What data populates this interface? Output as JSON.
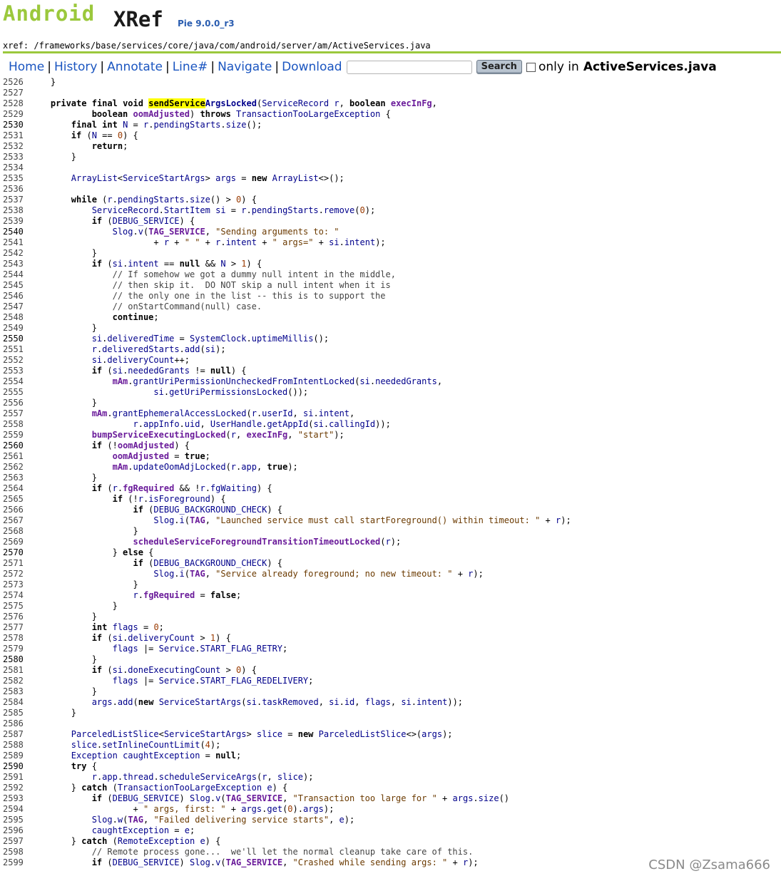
{
  "logo": {
    "android": "Android",
    "xref": "XRef",
    "version": "Pie 9.0.0_r3"
  },
  "path": "xref: /frameworks/base/services/core/java/com/android/server/am/ActiveServices.java",
  "nav": {
    "home": "Home",
    "history": "History",
    "annotate": "Annotate",
    "line": "Line#",
    "navigate": "Navigate",
    "download": "Download",
    "search_value": "",
    "search_button": "Search",
    "only_in_label": "only in",
    "only_in_file": "ActiveServices.java"
  },
  "code": {
    "lines": [
      {
        "n": "2526",
        "t": "    }"
      },
      {
        "n": "2527",
        "t": ""
      },
      {
        "n": "2528",
        "t": "    private final void sendServiceArgsLocked(ServiceRecord r, boolean execInFg,"
      },
      {
        "n": "2529",
        "t": "            boolean oomAdjusted) throws TransactionTooLargeException {"
      },
      {
        "n": "2530",
        "t": "        final int N = r.pendingStarts.size();"
      },
      {
        "n": "2531",
        "t": "        if (N == 0) {"
      },
      {
        "n": "2532",
        "t": "            return;"
      },
      {
        "n": "2533",
        "t": "        }"
      },
      {
        "n": "2534",
        "t": ""
      },
      {
        "n": "2535",
        "t": "        ArrayList<ServiceStartArgs> args = new ArrayList<>();"
      },
      {
        "n": "2536",
        "t": ""
      },
      {
        "n": "2537",
        "t": "        while (r.pendingStarts.size() > 0) {"
      },
      {
        "n": "2538",
        "t": "            ServiceRecord.StartItem si = r.pendingStarts.remove(0);"
      },
      {
        "n": "2539",
        "t": "            if (DEBUG_SERVICE) {"
      },
      {
        "n": "2540",
        "t": "                Slog.v(TAG_SERVICE, \"Sending arguments to: \""
      },
      {
        "n": "2541",
        "t": "                        + r + \" \" + r.intent + \" args=\" + si.intent);"
      },
      {
        "n": "2542",
        "t": "            }"
      },
      {
        "n": "2543",
        "t": "            if (si.intent == null && N > 1) {"
      },
      {
        "n": "2544",
        "t": "                // If somehow we got a dummy null intent in the middle,"
      },
      {
        "n": "2545",
        "t": "                // then skip it.  DO NOT skip a null intent when it is"
      },
      {
        "n": "2546",
        "t": "                // the only one in the list -- this is to support the"
      },
      {
        "n": "2547",
        "t": "                // onStartCommand(null) case."
      },
      {
        "n": "2548",
        "t": "                continue;"
      },
      {
        "n": "2549",
        "t": "            }"
      },
      {
        "n": "2550",
        "t": "            si.deliveredTime = SystemClock.uptimeMillis();"
      },
      {
        "n": "2551",
        "t": "            r.deliveredStarts.add(si);"
      },
      {
        "n": "2552",
        "t": "            si.deliveryCount++;"
      },
      {
        "n": "2553",
        "t": "            if (si.neededGrants != null) {"
      },
      {
        "n": "2554",
        "t": "                mAm.grantUriPermissionUncheckedFromIntentLocked(si.neededGrants,"
      },
      {
        "n": "2555",
        "t": "                        si.getUriPermissionsLocked());"
      },
      {
        "n": "2556",
        "t": "            }"
      },
      {
        "n": "2557",
        "t": "            mAm.grantEphemeralAccessLocked(r.userId, si.intent,"
      },
      {
        "n": "2558",
        "t": "                    r.appInfo.uid, UserHandle.getAppId(si.callingId));"
      },
      {
        "n": "2559",
        "t": "            bumpServiceExecutingLocked(r, execInFg, \"start\");"
      },
      {
        "n": "2560",
        "t": "            if (!oomAdjusted) {"
      },
      {
        "n": "2561",
        "t": "                oomAdjusted = true;"
      },
      {
        "n": "2562",
        "t": "                mAm.updateOomAdjLocked(r.app, true);"
      },
      {
        "n": "2563",
        "t": "            }"
      },
      {
        "n": "2564",
        "t": "            if (r.fgRequired && !r.fgWaiting) {"
      },
      {
        "n": "2565",
        "t": "                if (!r.isForeground) {"
      },
      {
        "n": "2566",
        "t": "                    if (DEBUG_BACKGROUND_CHECK) {"
      },
      {
        "n": "2567",
        "t": "                        Slog.i(TAG, \"Launched service must call startForeground() within timeout: \" + r);"
      },
      {
        "n": "2568",
        "t": "                    }"
      },
      {
        "n": "2569",
        "t": "                    scheduleServiceForegroundTransitionTimeoutLocked(r);"
      },
      {
        "n": "2570",
        "t": "                } else {"
      },
      {
        "n": "2571",
        "t": "                    if (DEBUG_BACKGROUND_CHECK) {"
      },
      {
        "n": "2572",
        "t": "                        Slog.i(TAG, \"Service already foreground; no new timeout: \" + r);"
      },
      {
        "n": "2573",
        "t": "                    }"
      },
      {
        "n": "2574",
        "t": "                    r.fgRequired = false;"
      },
      {
        "n": "2575",
        "t": "                }"
      },
      {
        "n": "2576",
        "t": "            }"
      },
      {
        "n": "2577",
        "t": "            int flags = 0;"
      },
      {
        "n": "2578",
        "t": "            if (si.deliveryCount > 1) {"
      },
      {
        "n": "2579",
        "t": "                flags |= Service.START_FLAG_RETRY;"
      },
      {
        "n": "2580",
        "t": "            }"
      },
      {
        "n": "2581",
        "t": "            if (si.doneExecutingCount > 0) {"
      },
      {
        "n": "2582",
        "t": "                flags |= Service.START_FLAG_REDELIVERY;"
      },
      {
        "n": "2583",
        "t": "            }"
      },
      {
        "n": "2584",
        "t": "            args.add(new ServiceStartArgs(si.taskRemoved, si.id, flags, si.intent));"
      },
      {
        "n": "2585",
        "t": "        }"
      },
      {
        "n": "2586",
        "t": ""
      },
      {
        "n": "2587",
        "t": "        ParceledListSlice<ServiceStartArgs> slice = new ParceledListSlice<>(args);"
      },
      {
        "n": "2588",
        "t": "        slice.setInlineCountLimit(4);"
      },
      {
        "n": "2589",
        "t": "        Exception caughtException = null;"
      },
      {
        "n": "2590",
        "t": "        try {"
      },
      {
        "n": "2591",
        "t": "            r.app.thread.scheduleServiceArgs(r, slice);"
      },
      {
        "n": "2592",
        "t": "        } catch (TransactionTooLargeException e) {"
      },
      {
        "n": "2593",
        "t": "            if (DEBUG_SERVICE) Slog.v(TAG_SERVICE, \"Transaction too large for \" + args.size()"
      },
      {
        "n": "2594",
        "t": "                    + \" args, first: \" + args.get(0).args);"
      },
      {
        "n": "2595",
        "t": "            Slog.w(TAG, \"Failed delivering service starts\", e);"
      },
      {
        "n": "2596",
        "t": "            caughtException = e;"
      },
      {
        "n": "2597",
        "t": "        } catch (RemoteException e) {"
      },
      {
        "n": "2598",
        "t": "            // Remote process gone...  we'll let the normal cleanup take care of this."
      },
      {
        "n": "2599",
        "t": "            if (DEBUG_SERVICE) Slog.v(TAG_SERVICE, \"Crashed while sending args: \" + r);"
      }
    ],
    "bold_line_numbers": [
      "2530",
      "2540",
      "2550",
      "2560",
      "2570",
      "2580",
      "2590"
    ],
    "highlight_term": "sendService"
  },
  "watermark": "CSDN @Zsama666"
}
